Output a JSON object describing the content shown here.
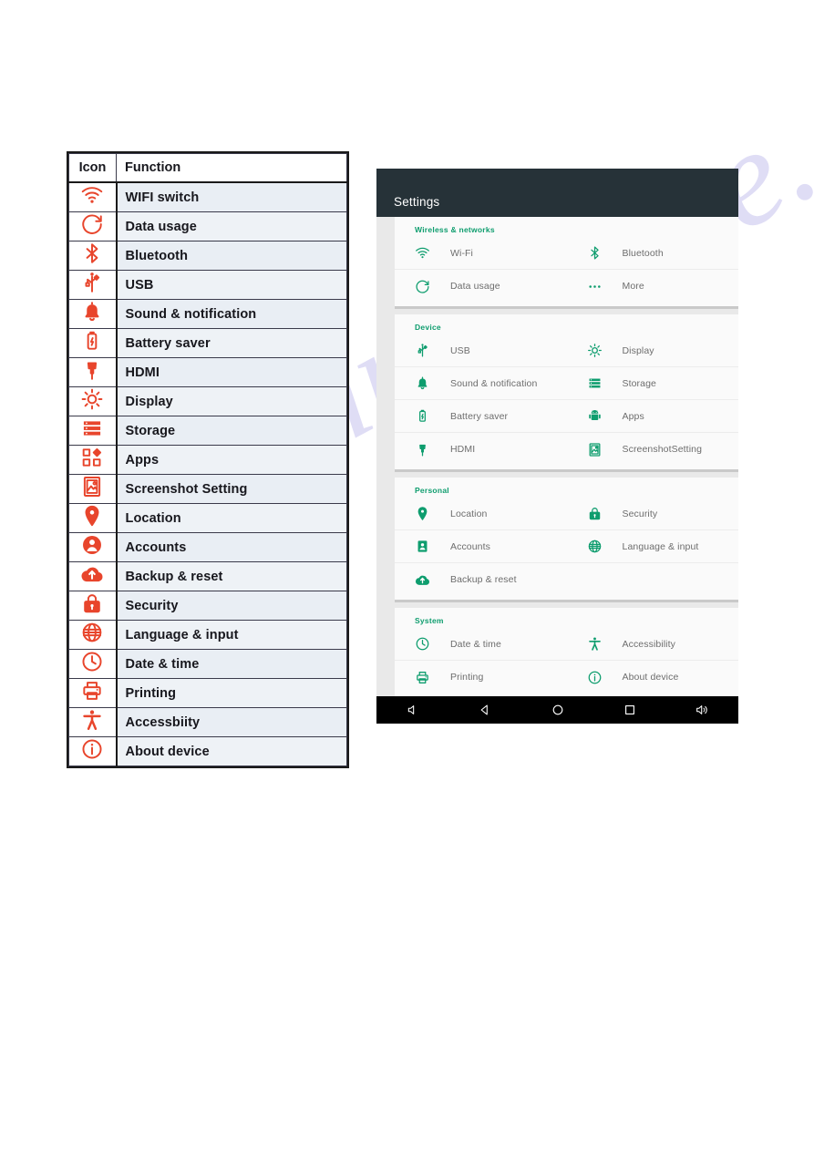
{
  "watermark": {
    "text": "manualshive.com"
  },
  "icon_table": {
    "headers": {
      "icon": "Icon",
      "function": "Function"
    },
    "rows": [
      {
        "icon": "wifi-icon",
        "label": "WIFI switch"
      },
      {
        "icon": "data-usage-icon",
        "label": "Data usage"
      },
      {
        "icon": "bluetooth-icon",
        "label": "Bluetooth"
      },
      {
        "icon": "usb-icon",
        "label": "USB"
      },
      {
        "icon": "bell-icon",
        "label": "Sound & notification"
      },
      {
        "icon": "battery-icon",
        "label": "Battery saver"
      },
      {
        "icon": "hdmi-icon",
        "label": "HDMI"
      },
      {
        "icon": "brightness-icon",
        "label": "Display"
      },
      {
        "icon": "storage-icon",
        "label": "Storage"
      },
      {
        "icon": "apps-grid-icon",
        "label": "Apps"
      },
      {
        "icon": "screenshot-icon",
        "label": "Screenshot Setting"
      },
      {
        "icon": "location-pin-icon",
        "label": "Location"
      },
      {
        "icon": "accounts-person-icon",
        "label": "Accounts"
      },
      {
        "icon": "backup-cloud-icon",
        "label": "Backup & reset"
      },
      {
        "icon": "lock-icon",
        "label": "Security"
      },
      {
        "icon": "globe-icon",
        "label": "Language & input"
      },
      {
        "icon": "clock-icon",
        "label": "Date & time"
      },
      {
        "icon": "printer-icon",
        "label": "Printing"
      },
      {
        "icon": "accessibility-icon",
        "label": "Accessbiity"
      },
      {
        "icon": "info-icon",
        "label": "About device"
      }
    ],
    "colors": {
      "icon": "#e8452c",
      "label_bg": "#e9eef4",
      "border": "#1a1a1a"
    }
  },
  "android_settings": {
    "appbar": {
      "title": "Settings",
      "bg": "#263238"
    },
    "accent": "#0e9d6e",
    "sections": [
      {
        "title": "Wireless & networks",
        "items": [
          {
            "icon": "wifi-icon",
            "label": "Wi-Fi"
          },
          {
            "icon": "bluetooth-icon",
            "label": "Bluetooth"
          },
          {
            "icon": "data-usage-icon",
            "label": "Data usage"
          },
          {
            "icon": "more-dots-icon",
            "label": "More"
          }
        ]
      },
      {
        "title": "Device",
        "items": [
          {
            "icon": "usb-icon",
            "label": "USB"
          },
          {
            "icon": "brightness-icon",
            "label": "Display"
          },
          {
            "icon": "bell-icon",
            "label": "Sound & notification"
          },
          {
            "icon": "storage-icon",
            "label": "Storage"
          },
          {
            "icon": "battery-icon",
            "label": "Battery saver"
          },
          {
            "icon": "apps-android-icon",
            "label": "Apps"
          },
          {
            "icon": "hdmi-icon",
            "label": "HDMI"
          },
          {
            "icon": "screenshot-icon",
            "label": "ScreenshotSetting"
          }
        ]
      },
      {
        "title": "Personal",
        "items": [
          {
            "icon": "location-pin-icon",
            "label": "Location"
          },
          {
            "icon": "lock-icon",
            "label": "Security"
          },
          {
            "icon": "accounts-badge-icon",
            "label": "Accounts"
          },
          {
            "icon": "globe-icon",
            "label": "Language & input"
          },
          {
            "icon": "backup-cloud-icon",
            "label": "Backup & reset"
          },
          {
            "icon": "",
            "label": ""
          }
        ]
      },
      {
        "title": "System",
        "items": [
          {
            "icon": "clock-icon",
            "label": "Date & time"
          },
          {
            "icon": "accessibility-icon",
            "label": "Accessibility"
          },
          {
            "icon": "printer-icon",
            "label": "Printing"
          },
          {
            "icon": "info-icon",
            "label": "About device"
          }
        ]
      }
    ],
    "navbar": {
      "buttons": [
        {
          "icon": "volume-down-icon",
          "label": "Volume down"
        },
        {
          "icon": "back-icon",
          "label": "Back"
        },
        {
          "icon": "home-icon",
          "label": "Home"
        },
        {
          "icon": "recents-icon",
          "label": "Recents"
        },
        {
          "icon": "volume-up-icon",
          "label": "Volume up"
        }
      ]
    }
  }
}
